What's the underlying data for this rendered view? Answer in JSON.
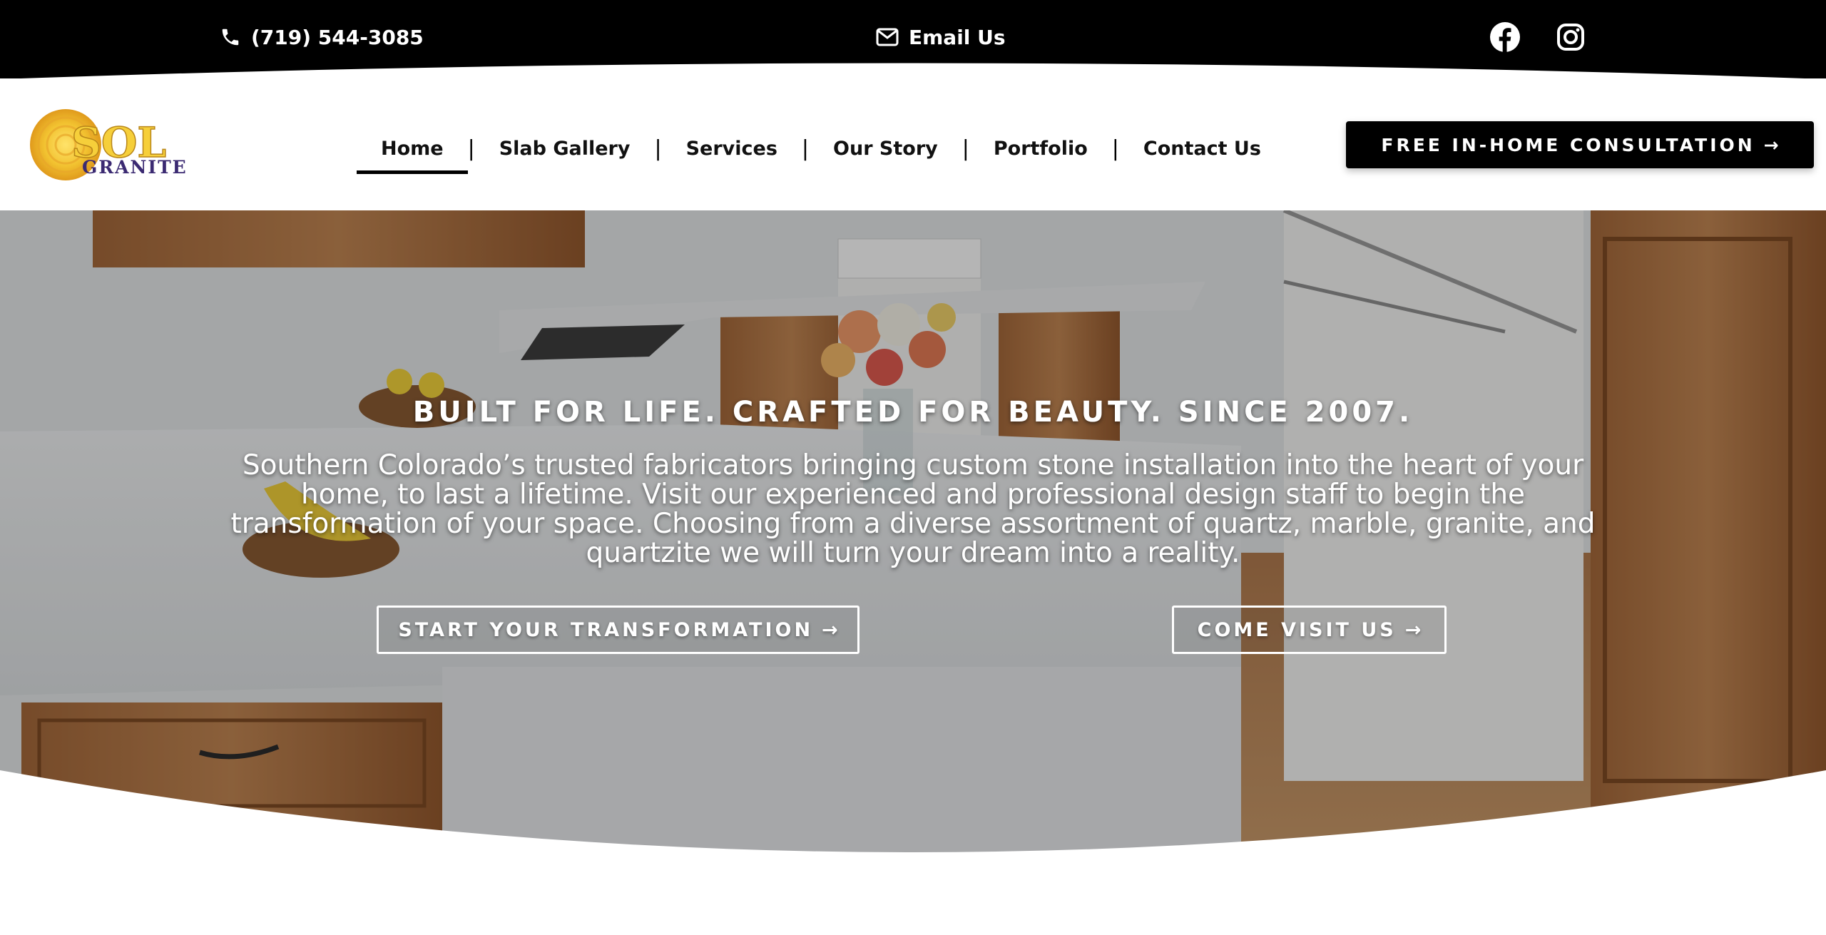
{
  "topbar": {
    "phone": "(719) 544-3085",
    "email_label": "Email Us",
    "social": [
      "facebook-icon",
      "instagram-icon"
    ]
  },
  "header": {
    "logo": {
      "line1": "SOL",
      "line2": "GRANITE"
    },
    "nav": [
      {
        "label": "Home",
        "active": true
      },
      {
        "label": "Slab Gallery",
        "active": false
      },
      {
        "label": "Services",
        "active": false
      },
      {
        "label": "Our Story",
        "active": false
      },
      {
        "label": "Portfolio",
        "active": false
      },
      {
        "label": "Contact Us",
        "active": false
      }
    ],
    "separator": "|",
    "cta_label": "FREE IN-HOME CONSULTATION",
    "arrow": "→"
  },
  "hero": {
    "title": "BUILT FOR LIFE. CRAFTED FOR BEAUTY. SINCE 2007.",
    "text": "Southern Colorado’s trusted fabricators bringing custom stone installation into the heart of your home, to last a lifetime. Visit our experienced and professional design staff to begin the transformation of your space. Choosing from a diverse assortment of quartz, marble, granite, and quartzite we will turn your dream into a reality.",
    "buttons": [
      {
        "label": "START YOUR TRANSFORMATION"
      },
      {
        "label": "COME VISIT US"
      }
    ]
  },
  "colors": {
    "topbar": "#000000",
    "cta": "#000000",
    "logo_sun": "#f2c230",
    "logo_text": "#3b2a72"
  }
}
